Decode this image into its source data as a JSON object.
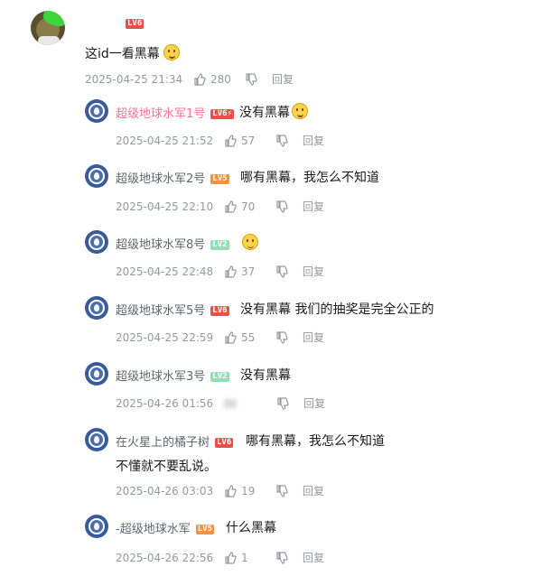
{
  "root": {
    "username": "",
    "level": "LV6",
    "text": "这id一看黑幕",
    "time": "2025-04-25 21:34",
    "likes": "280",
    "reply_label": "回复"
  },
  "replies": [
    {
      "name": "超级地球水军1号",
      "level": "LV6⚡",
      "level_class": "lv6",
      "pink": true,
      "text": "没有黑幕",
      "emoji": true,
      "time": "2025-04-25 21:52",
      "likes": "57",
      "reply_label": "回复"
    },
    {
      "name": "超级地球水军2号",
      "level": "LV5",
      "level_class": "lv5",
      "text": "哪有黑幕，我怎么不知道",
      "time": "2025-04-25 22:10",
      "likes": "70",
      "reply_label": "回复"
    },
    {
      "name": "超级地球水军8号",
      "level": "LV2",
      "level_class": "lv2",
      "text": "",
      "emoji": true,
      "time": "2025-04-25 22:48",
      "likes": "37",
      "reply_label": "回复"
    },
    {
      "name": "超级地球水军5号",
      "level": "LV6",
      "level_class": "lv6",
      "text": "没有黑幕 我们的抽奖是完全公正的",
      "time": "2025-04-25 22:59",
      "likes": "55",
      "reply_label": "回复"
    },
    {
      "name": "超级地球水军3号",
      "level": "LV2",
      "level_class": "lv2",
      "text": "没有黑幕",
      "time": "2025-04-26 01:56",
      "likes": "",
      "reply_label": "回复"
    },
    {
      "name": "在火星上的橘子树",
      "level": "LV6",
      "level_class": "lv6",
      "text": "哪有黑幕，我怎么不知道",
      "text2": "不懂就不要乱说。",
      "time": "2025-04-26 03:03",
      "likes": "19",
      "reply_label": "回复"
    },
    {
      "name": "-超级地球水军",
      "level": "LV5",
      "level_class": "lv5",
      "text": "什么黑幕",
      "time": "2025-04-26 22:56",
      "likes": "1",
      "reply_label": "回复"
    }
  ],
  "colors": {
    "accent_pink": "#fb7299",
    "meta_gray": "#9499a0",
    "level6": "#f04c49",
    "level5": "#ff8f3c",
    "level2": "#95ddb2"
  }
}
